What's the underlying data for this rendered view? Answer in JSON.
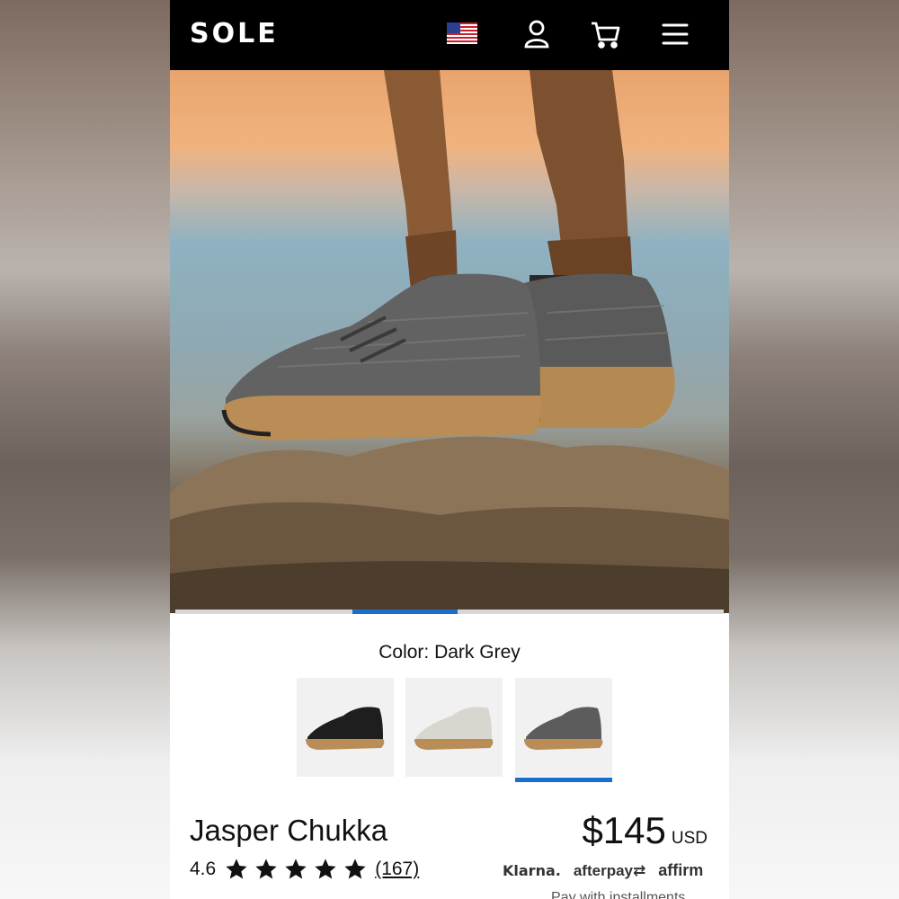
{
  "header": {
    "logo": "SOLE",
    "flag": "us-flag-icon",
    "icons": [
      "account-icon",
      "cart-icon",
      "menu-icon"
    ]
  },
  "hero": {
    "image": "product photo of grey knit shoes on rocks",
    "carousel": {
      "active_index": 2,
      "total": 5
    }
  },
  "product": {
    "color_label": "Color: Dark Grey",
    "swatches": [
      {
        "name": "Black",
        "selected": false
      },
      {
        "name": "Light Grey",
        "selected": false
      },
      {
        "name": "Dark Grey",
        "selected": true
      }
    ],
    "title": "Jasper Chukka",
    "rating": "4.6",
    "stars": 5,
    "review_count": "(167)",
    "price": "$145",
    "currency": "USD",
    "payment": {
      "klarna": "Klarna.",
      "afterpay": "afterpay",
      "affirm": "affirm",
      "installments": "Pay with installments"
    }
  },
  "colors": {
    "accent": "#1a6fcc",
    "header_bg": "#000000"
  }
}
